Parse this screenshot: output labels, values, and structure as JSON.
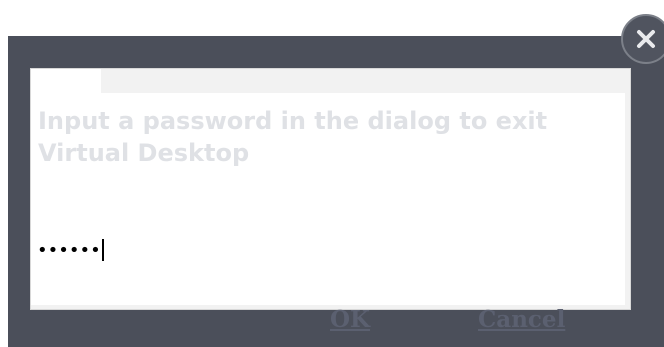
{
  "dialog": {
    "prompt": "Input a password in the dialog to exit Virtual Desktop",
    "password_masked": "••••••",
    "ok_label": "OK",
    "cancel_label": "Cancel",
    "close_icon": "close-icon"
  },
  "colors": {
    "frame": "#4b4f5a",
    "panel": "#f2f2f2",
    "prompt_text": "#dfe1e5",
    "button_text": "#5b6070"
  }
}
